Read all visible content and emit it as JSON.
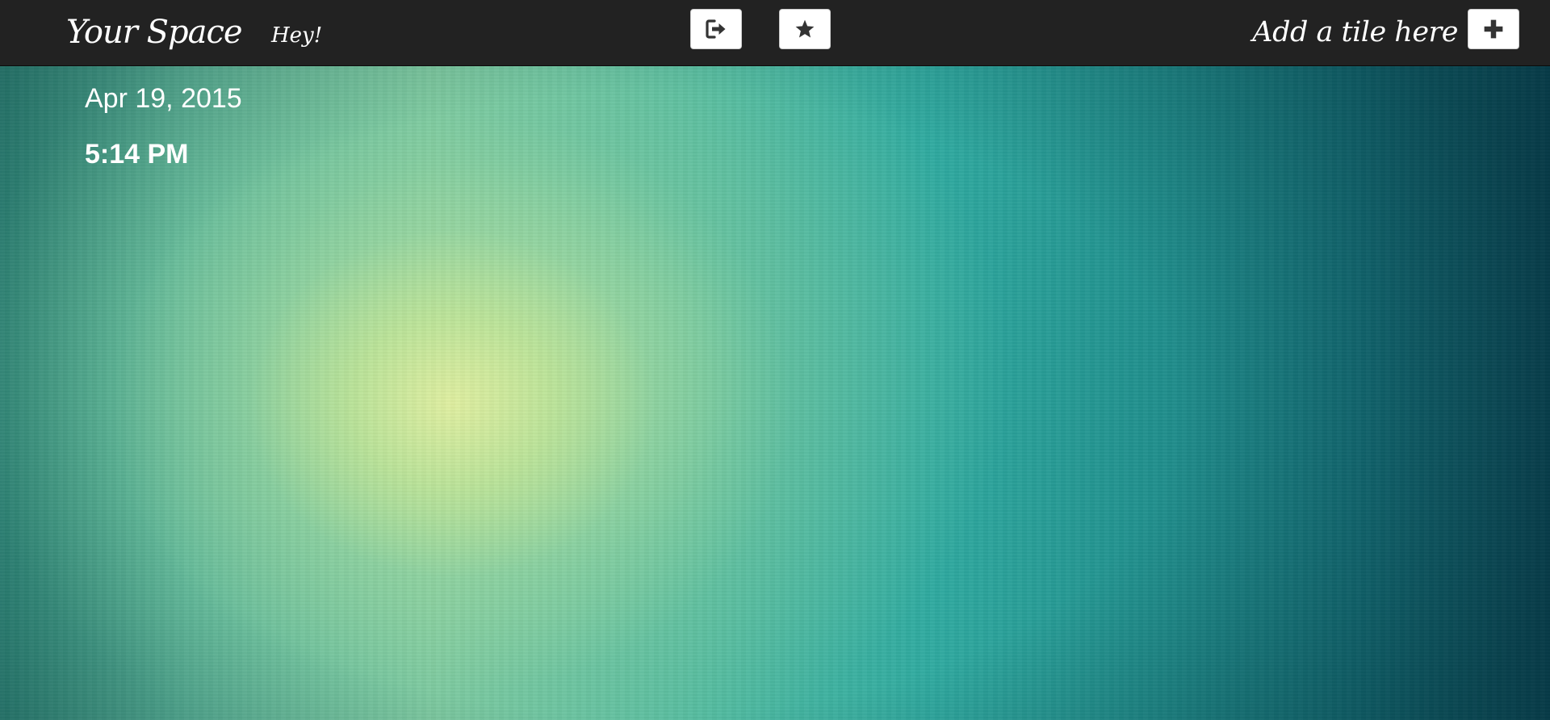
{
  "header": {
    "brand": "Your Space",
    "greeting": "Hey!",
    "add_tile_label": "Add a tile here",
    "buttons": [
      {
        "name": "logout",
        "icon": "sign-out-icon"
      },
      {
        "name": "favorites",
        "icon": "star-icon"
      },
      {
        "name": "add-tile",
        "icon": "plus-icon"
      }
    ]
  },
  "clock": {
    "date": "Apr 19, 2015",
    "time": "5:14 PM"
  },
  "colors": {
    "topbar": "#222222",
    "text": "#ffffff",
    "button_bg": "#ffffff",
    "icon": "#333333"
  }
}
